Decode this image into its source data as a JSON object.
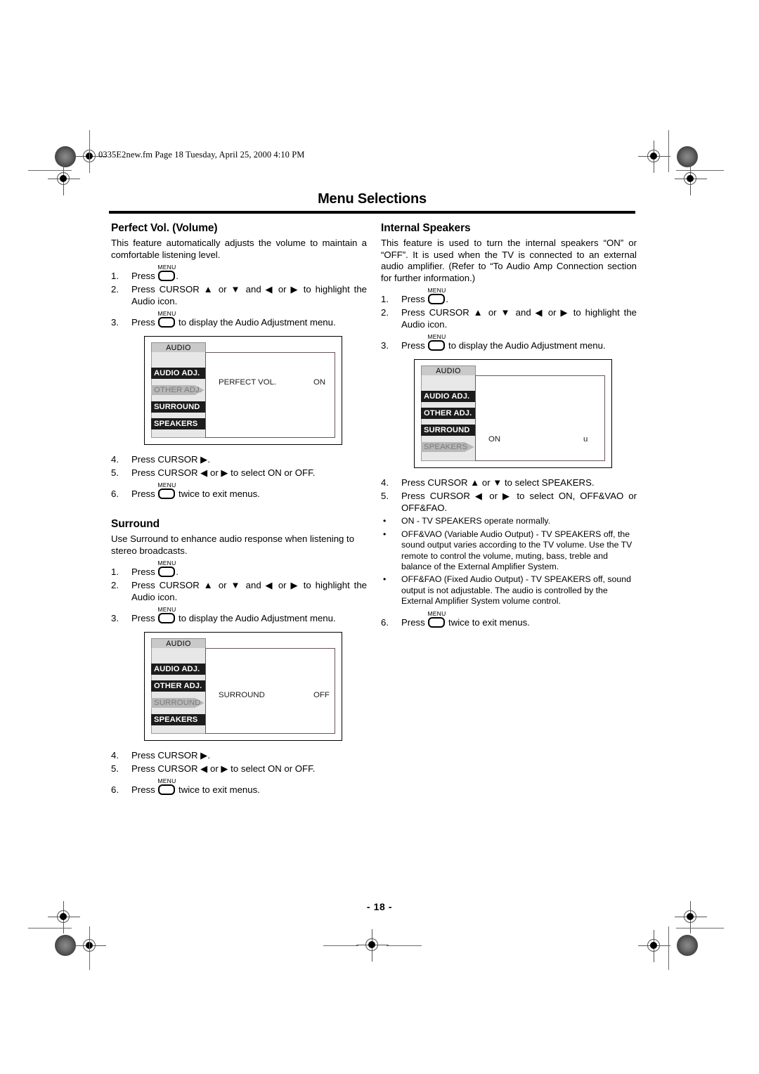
{
  "header": {
    "file_stamp": "0335E2new.fm  Page 18  Tuesday, April 25, 2000  4:10 PM",
    "title": "Menu Selections"
  },
  "footer": {
    "page_number": "- 18 -"
  },
  "icons": {
    "menu_key_label": "MENU",
    "cursor_up": "▲",
    "cursor_down": "▼",
    "cursor_left": "◀",
    "cursor_right": "▶",
    "bullet": "•"
  },
  "colors": {
    "chip_fill": "#1c1c1c",
    "chip_text": "#ffffff",
    "rail_fill": "#e7e7e7",
    "selected_arrow": "#b8b8b8",
    "tab_fill": "#c9c9c9",
    "panel_border": "#6b5360"
  },
  "left_column": {
    "sections": [
      {
        "heading": "Perfect Vol. (Volume)",
        "intro": "This feature automatically adjusts the volume to maintain a comfortable listening level.",
        "steps": [
          {
            "num": "1.",
            "pre": "Press ",
            "menu_key": true,
            "post": "."
          },
          {
            "num": "2.",
            "pre": "Press CURSOR ▲ or ▼ and ◀ or ▶ to highlight the Audio icon.",
            "menu_key": false,
            "post": ""
          },
          {
            "num": "3.",
            "pre": "Press ",
            "menu_key": true,
            "post": " to display the Audio Adjustment menu."
          }
        ],
        "osd": {
          "tab": "AUDIO",
          "items": [
            {
              "label": "AUDIO ADJ.",
              "selected": false
            },
            {
              "label": "OTHER ADJ.",
              "selected": true
            },
            {
              "label": "SURROUND",
              "selected": false
            },
            {
              "label": "SPEAKERS",
              "selected": false
            }
          ],
          "value_name": "PERFECT VOL.",
          "value": "ON",
          "value_row_index": 1
        },
        "steps_after": [
          {
            "num": "4.",
            "pre": "Press CURSOR ▶.",
            "menu_key": false,
            "post": ""
          },
          {
            "num": "5.",
            "pre": "Press CURSOR ◀ or ▶ to select ON or OFF.",
            "menu_key": false,
            "post": ""
          },
          {
            "num": "6.",
            "pre": "Press ",
            "menu_key": true,
            "post": " twice to exit menus."
          }
        ]
      },
      {
        "heading": "Surround",
        "intro": "Use Surround to enhance audio response when listening to stereo broadcasts.",
        "steps": [
          {
            "num": "1.",
            "pre": "Press ",
            "menu_key": true,
            "post": "."
          },
          {
            "num": "2.",
            "pre": "Press CURSOR ▲ or ▼ and ◀ or ▶ to highlight the Audio icon.",
            "menu_key": false,
            "post": ""
          },
          {
            "num": "3.",
            "pre": "Press ",
            "menu_key": true,
            "post": " to display the Audio Adjustment menu."
          }
        ],
        "osd": {
          "tab": "AUDIO",
          "items": [
            {
              "label": "AUDIO ADJ.",
              "selected": false
            },
            {
              "label": "OTHER ADJ.",
              "selected": false
            },
            {
              "label": "SURROUND",
              "selected": true
            },
            {
              "label": "SPEAKERS",
              "selected": false
            }
          ],
          "value_name": "SURROUND",
          "value": "OFF",
          "value_row_index": 2
        },
        "steps_after": [
          {
            "num": "4.",
            "pre": "Press CURSOR ▶.",
            "menu_key": false,
            "post": ""
          },
          {
            "num": "5.",
            "pre": "Press CURSOR ◀ or ▶ to select ON or OFF.",
            "menu_key": false,
            "post": ""
          },
          {
            "num": "6.",
            "pre": "Press ",
            "menu_key": true,
            "post": " twice to exit menus."
          }
        ]
      }
    ]
  },
  "right_column": {
    "sections": [
      {
        "heading": "Internal Speakers",
        "intro": "This feature is used to turn the internal speakers “ON” or “OFF”. It is used when the TV is connected to an external audio amplifier. (Refer to “To Audio Amp Connection section for further information.)",
        "steps": [
          {
            "num": "1.",
            "pre": "Press ",
            "menu_key": true,
            "post": "."
          },
          {
            "num": "2.",
            "pre": "Press CURSOR ▲ or ▼ and ◀ or ▶ to highlight the Audio icon.",
            "menu_key": false,
            "post": ""
          },
          {
            "num": "3.",
            "pre": "Press ",
            "menu_key": true,
            "post": " to display the Audio Adjustment menu."
          }
        ],
        "osd": {
          "tab": "AUDIO",
          "items": [
            {
              "label": "AUDIO ADJ.",
              "selected": false
            },
            {
              "label": "OTHER ADJ.",
              "selected": false
            },
            {
              "label": "SURROUND",
              "selected": false
            },
            {
              "label": "SPEAKERS",
              "selected": true
            }
          ],
          "value_name": "ON",
          "value": "u",
          "value_row_index": 3
        },
        "steps_after": [
          {
            "num": "4.",
            "pre": "Press CURSOR ▲ or ▼ to select SPEAKERS.",
            "menu_key": false,
            "post": ""
          },
          {
            "num": "5.",
            "pre": "Press CURSOR ◀ or ▶ to select ON, OFF&VAO or OFF&FAO.",
            "menu_key": false,
            "post": ""
          }
        ],
        "bullets": [
          "ON - TV SPEAKERS operate normally.",
          "OFF&VAO (Variable Audio Output) - TV SPEAKERS off, the sound output varies according to the TV volume. Use the TV remote to control the volume, muting, bass, treble and balance of the External Amplifier System.",
          "OFF&FAO (Fixed Audio Output) - TV SPEAKERS off, sound output is not adjustable. The audio is controlled by the External Amplifier System volume control."
        ],
        "steps_final": [
          {
            "num": "6.",
            "pre": "Press ",
            "menu_key": true,
            "post": " twice to exit menus."
          }
        ]
      }
    ]
  }
}
